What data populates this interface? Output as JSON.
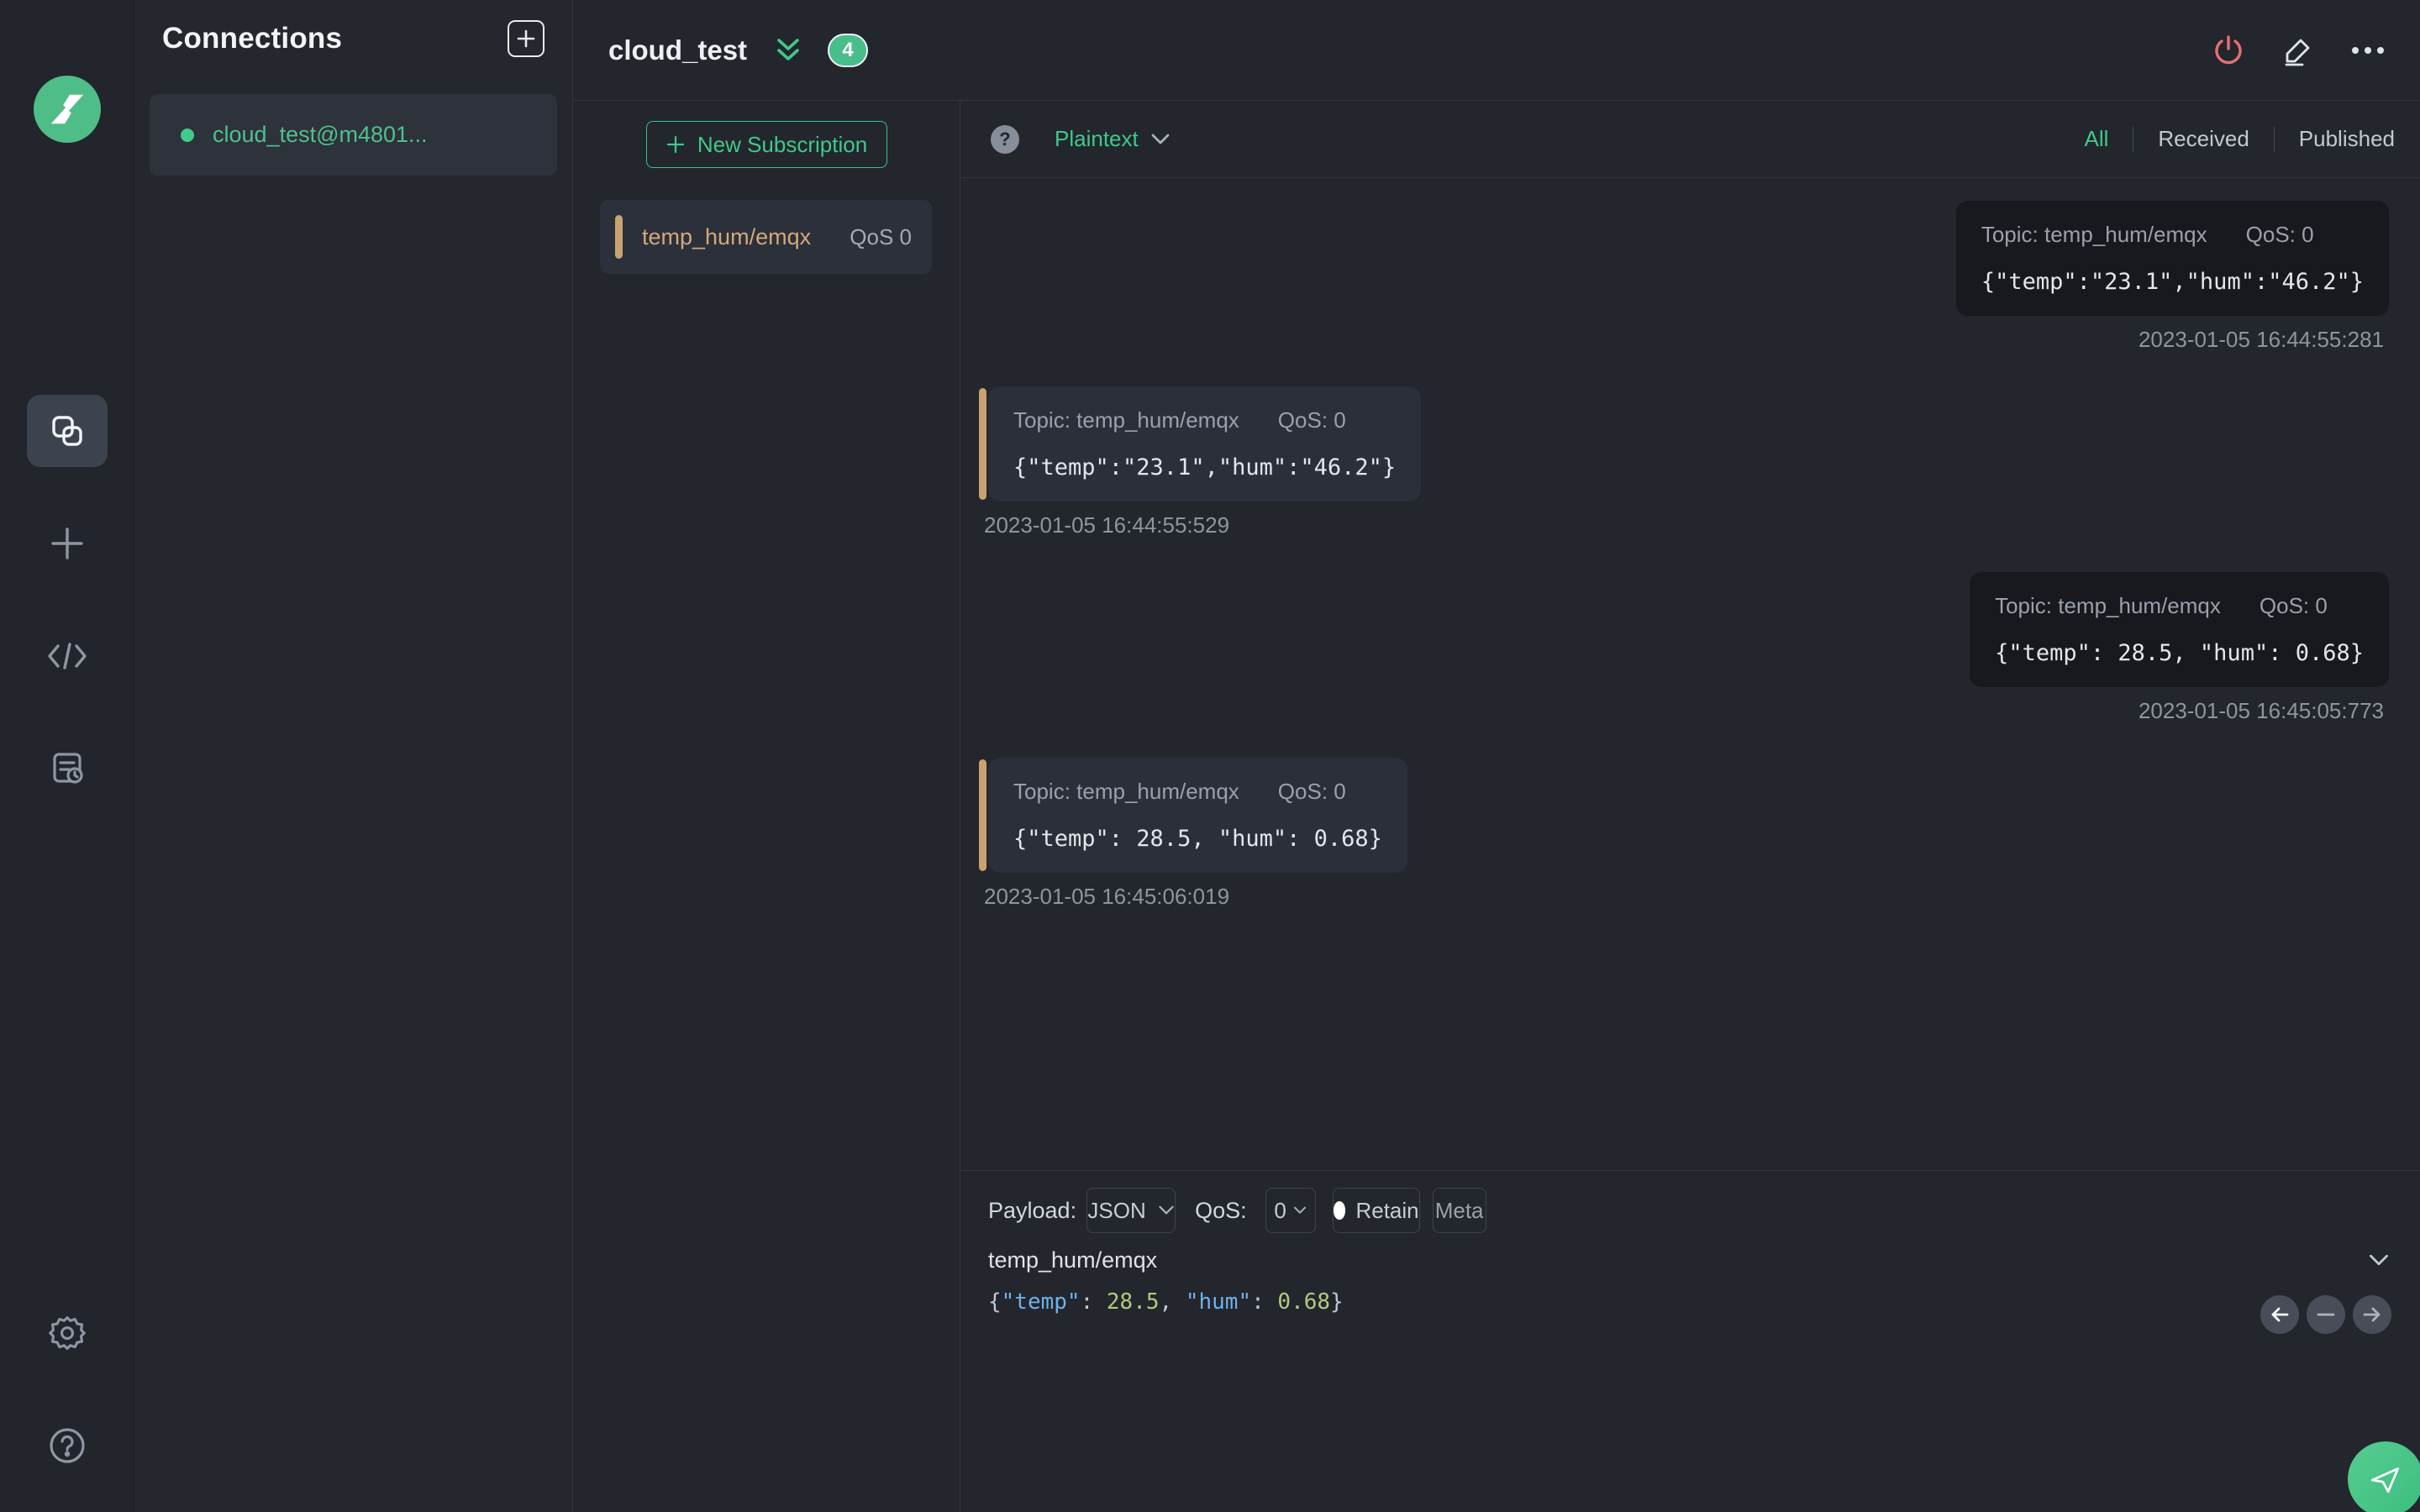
{
  "colors": {
    "accent_green": "#3fc98b",
    "topic_tan": "#d2a97c",
    "danger_red": "#e57070"
  },
  "connections": {
    "title": "Connections",
    "items": [
      {
        "name": "cloud_test@m4801...",
        "connected": true
      }
    ]
  },
  "header": {
    "title": "cloud_test",
    "badge_count": "4"
  },
  "subscriptions": {
    "new_button_label": "New Subscription",
    "items": [
      {
        "topic": "temp_hum/emqx",
        "qos": "QoS 0"
      }
    ]
  },
  "messages": {
    "help_glyph": "?",
    "format_label": "Plaintext",
    "tabs": [
      {
        "label": "All"
      },
      {
        "label": "Received"
      },
      {
        "label": "Published"
      }
    ],
    "items": [
      {
        "direction": "published",
        "topic_label": "Topic: temp_hum/emqx",
        "qos_label": "QoS: 0",
        "payload": "{\"temp\":\"23.1\",\"hum\":\"46.2\"}",
        "timestamp": "2023-01-05 16:44:55:281"
      },
      {
        "direction": "received",
        "topic_label": "Topic: temp_hum/emqx",
        "qos_label": "QoS: 0",
        "payload": "{\"temp\":\"23.1\",\"hum\":\"46.2\"}",
        "timestamp": "2023-01-05 16:44:55:529"
      },
      {
        "direction": "published",
        "topic_label": "Topic: temp_hum/emqx",
        "qos_label": "QoS: 0",
        "payload": "{\"temp\": 28.5, \"hum\": 0.68}",
        "timestamp": "2023-01-05 16:45:05:773"
      },
      {
        "direction": "received",
        "topic_label": "Topic: temp_hum/emqx",
        "qos_label": "QoS: 0",
        "payload": "{\"temp\": 28.5, \"hum\": 0.68}",
        "timestamp": "2023-01-05 16:45:06:019"
      }
    ]
  },
  "publish": {
    "payload_label": "Payload:",
    "payload_format": "JSON",
    "qos_label": "QoS:",
    "qos_value": "0",
    "retain_label": "Retain",
    "meta_label": "Meta",
    "topic_value": "temp_hum/emqx",
    "payload_tokens": [
      {
        "t": "{",
        "c": "punct"
      },
      {
        "t": "\"temp\"",
        "c": "key"
      },
      {
        "t": ": ",
        "c": "punct"
      },
      {
        "t": "28.5",
        "c": "num"
      },
      {
        "t": ", ",
        "c": "punct"
      },
      {
        "t": "\"hum\"",
        "c": "key"
      },
      {
        "t": ": ",
        "c": "punct"
      },
      {
        "t": "0.68",
        "c": "num"
      },
      {
        "t": "}",
        "c": "punct"
      }
    ]
  }
}
